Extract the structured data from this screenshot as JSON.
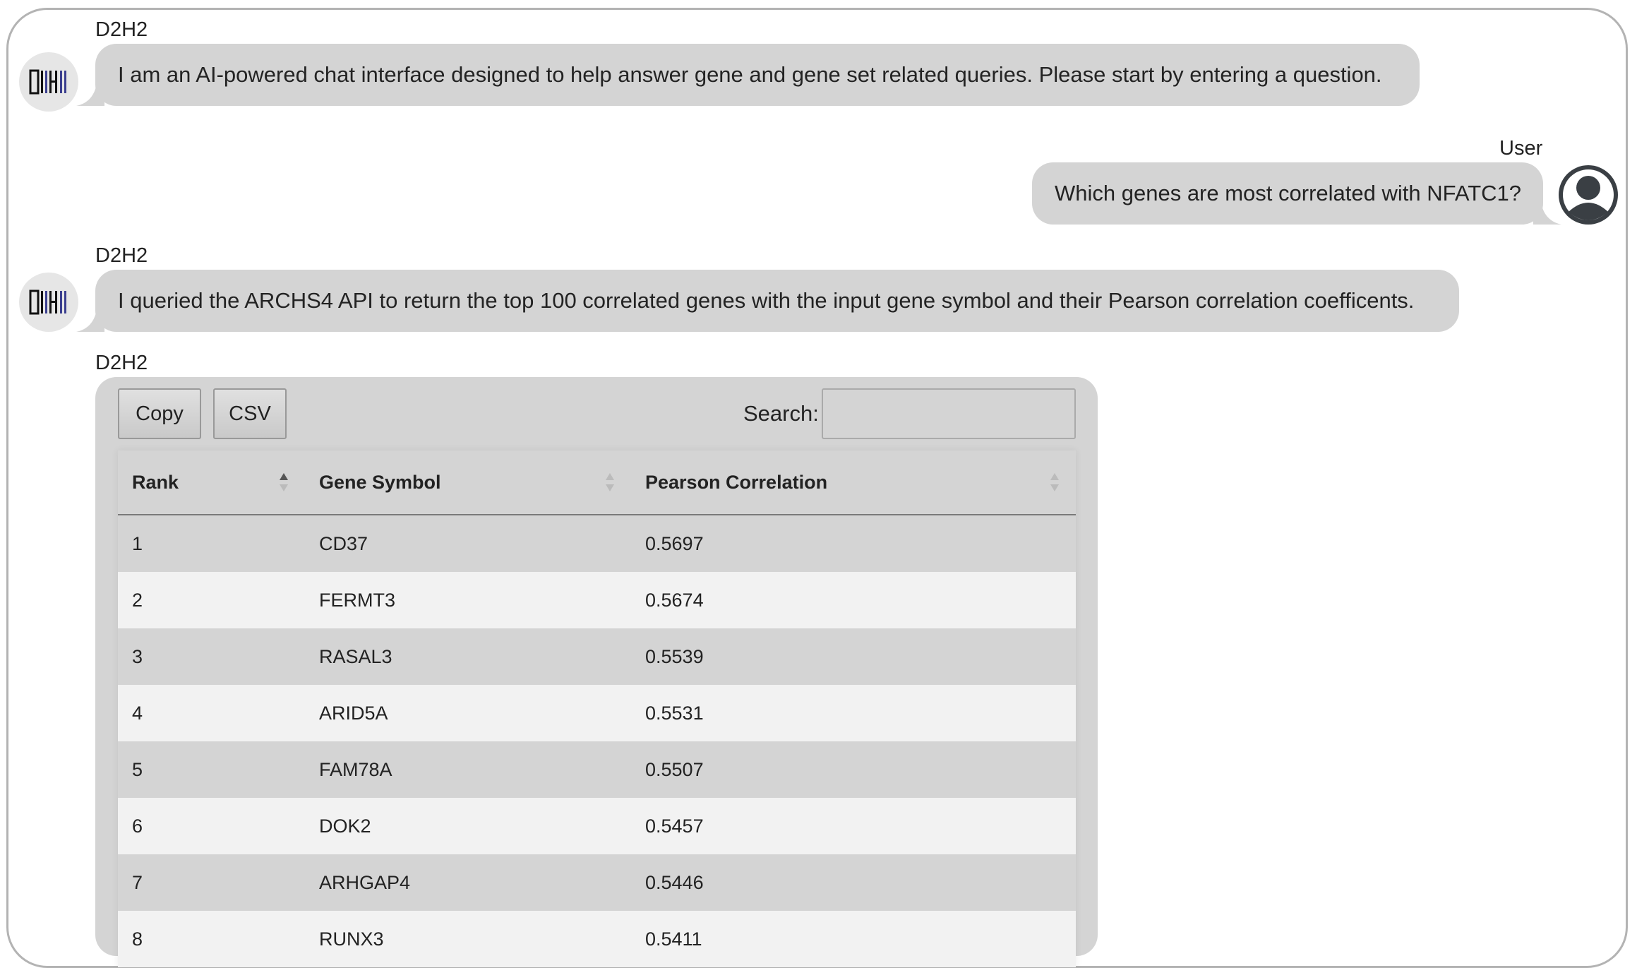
{
  "messages": [
    {
      "sender": "D2H2",
      "text": "I am an AI-powered chat interface designed to help answer gene and gene set related queries. Please start by entering a question."
    },
    {
      "sender": "User",
      "text": "Which genes are most correlated with NFATC1?"
    },
    {
      "sender": "D2H2",
      "text": "I queried the ARCHS4 API to return the top 100 correlated genes with the input gene symbol and their Pearson correlation coefficents."
    },
    {
      "sender": "D2H2"
    }
  ],
  "table": {
    "copy_label": "Copy",
    "csv_label": "CSV",
    "search_label": "Search:",
    "search_value": "",
    "columns": [
      "Rank",
      "Gene Symbol",
      "Pearson Correlation"
    ],
    "rows": [
      [
        "1",
        "CD37",
        "0.5697"
      ],
      [
        "2",
        "FERMT3",
        "0.5674"
      ],
      [
        "3",
        "RASAL3",
        "0.5539"
      ],
      [
        "4",
        "ARID5A",
        "0.5531"
      ],
      [
        "5",
        "FAM78A",
        "0.5507"
      ],
      [
        "6",
        "DOK2",
        "0.5457"
      ],
      [
        "7",
        "ARHGAP4",
        "0.5446"
      ],
      [
        "8",
        "RUNX3",
        "0.5411"
      ]
    ]
  },
  "icons": {
    "bot_avatar": "d2h2-logo-icon",
    "user_avatar": "user-circle-icon"
  },
  "colors": {
    "bubble": "#d4d4d4",
    "row_alt": "#f2f2f2",
    "logo_blue": "#3b3f8f"
  }
}
